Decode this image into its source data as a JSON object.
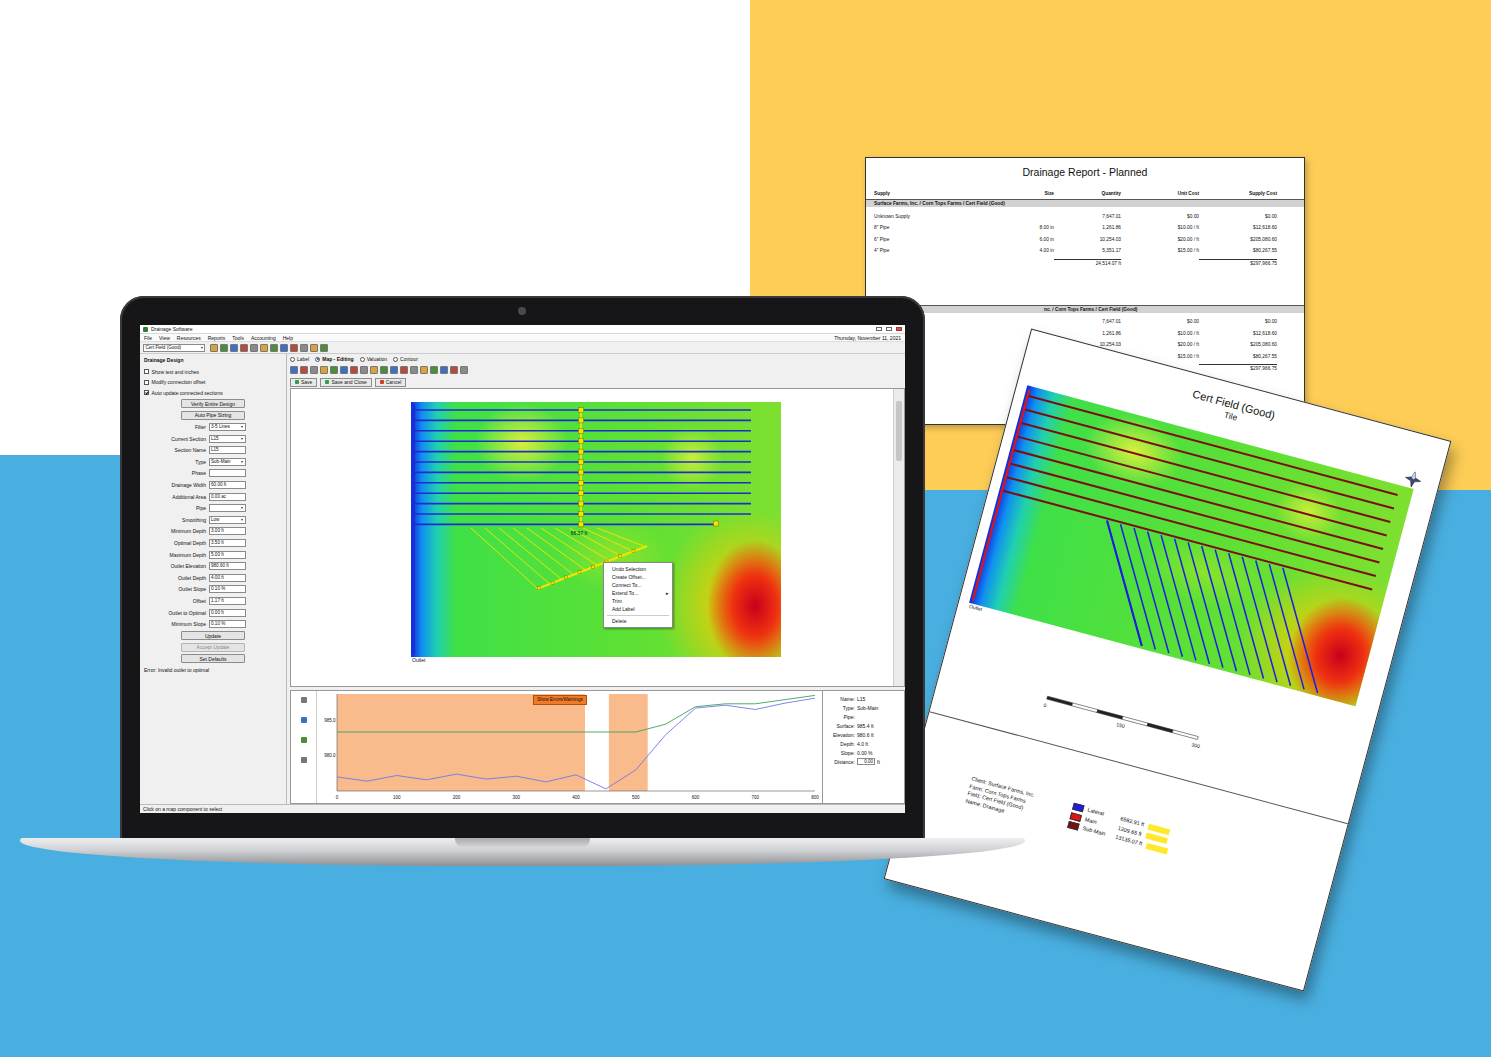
{
  "app": {
    "title": "Drainage Software",
    "menu": [
      "File",
      "View",
      "Resources",
      "Reports",
      "Tools",
      "Accounting",
      "Help"
    ],
    "date": "Thursday, November 11, 2021",
    "field_select": "Cert Field (Good)",
    "panel": {
      "heading": "Drainage Design",
      "items": [
        {
          "kind": "checkbox",
          "label": "Show text and inches",
          "checked": false
        },
        {
          "kind": "checkbox",
          "label": "Modify connection offset",
          "checked": false
        },
        {
          "kind": "checkbox",
          "label": "Auto update connected sections",
          "checked": true
        },
        {
          "kind": "button",
          "label": "Verify Entire Design",
          "disabled": false
        },
        {
          "kind": "button",
          "label": "Auto Pipe Sizing",
          "disabled": false
        },
        {
          "kind": "select",
          "label": "Filter",
          "value": "3-5 Lines"
        },
        {
          "kind": "select",
          "label": "Current Section",
          "value": "L15"
        },
        {
          "kind": "input",
          "label": "Section Name",
          "value": "L15"
        },
        {
          "kind": "select",
          "label": "Type",
          "value": "Sub-Main"
        },
        {
          "kind": "input",
          "label": "Phase"
        },
        {
          "kind": "input",
          "label": "Drainage Width",
          "value": "60.00 ft"
        },
        {
          "kind": "input",
          "label": "Additional Area",
          "value": "0.00 ac"
        },
        {
          "kind": "select",
          "label": "Pipe"
        },
        {
          "kind": "select",
          "label": "Smoothing",
          "value": "Low"
        },
        {
          "kind": "input",
          "label": "Minimum Depth",
          "value": "3.00 ft"
        },
        {
          "kind": "input",
          "label": "Optimal Depth",
          "value": "3.50 ft"
        },
        {
          "kind": "input",
          "label": "Maximum Depth",
          "value": "5.00 ft"
        },
        {
          "kind": "input",
          "label": "Outlet Elevation",
          "value": "980.60 ft"
        },
        {
          "kind": "input",
          "label": "Outlet Depth",
          "value": "4.00 ft"
        },
        {
          "kind": "input",
          "label": "Outlet Slope",
          "value": "0.10 %"
        },
        {
          "kind": "input",
          "label": "Offset",
          "value": "1.17 ft"
        },
        {
          "kind": "input",
          "label": "Outlet to Optimal",
          "value": "0.00 ft"
        },
        {
          "kind": "input",
          "label": "Minimum Slope",
          "value": "0.10 %"
        },
        {
          "kind": "button",
          "label": "Update",
          "disabled": false
        },
        {
          "kind": "button",
          "label": "Accept Update",
          "disabled": true
        },
        {
          "kind": "button",
          "label": "Set Defaults",
          "disabled": false
        },
        {
          "kind": "note",
          "label": "Error: Invalid outlet to optimal"
        }
      ]
    },
    "tabs": [
      {
        "label": "Label",
        "selected": false
      },
      {
        "label": "Map - Editing",
        "selected": true
      },
      {
        "label": "Valuation",
        "selected": false
      },
      {
        "label": "Contour",
        "selected": false
      }
    ],
    "actions": [
      "Save",
      "Save and Close",
      "Cancel"
    ],
    "map": {
      "outlet": "Outlet",
      "section_length": "66.37 ft",
      "groups": [
        {
          "kind": "main",
          "selected": false
        },
        {
          "kind": "laterals",
          "selected": false
        },
        {
          "kind": "sub-main",
          "selected": true
        },
        {
          "kind": "branch",
          "selected": true
        }
      ]
    },
    "context_menu": [
      {
        "kind": "item",
        "label": "Undo Selection"
      },
      {
        "kind": "item",
        "label": "Create Offset..."
      },
      {
        "kind": "item",
        "label": "Connect To..."
      },
      {
        "kind": "submenu",
        "label": "Extend To...",
        "arrow": "▸"
      },
      {
        "kind": "item",
        "label": "Trim"
      },
      {
        "kind": "item",
        "label": "Add Label"
      },
      {
        "kind": "separator"
      },
      {
        "kind": "item",
        "label": "Delete"
      }
    ],
    "profile": {
      "button": "Show Errors/Warnings",
      "y_ticks": [
        "985.0",
        "980.0"
      ],
      "x_ticks": [
        "0",
        "100",
        "200",
        "300",
        "400",
        "500",
        "600",
        "700",
        "800"
      ],
      "distance": [
        0,
        50,
        100,
        150,
        200,
        250,
        300,
        350,
        400,
        450,
        500,
        550,
        600,
        650,
        700,
        750,
        800
      ],
      "series": [
        {
          "name": "Surface",
          "color": "#6f78ec",
          "values": [
            977.0,
            976.4,
            977.2,
            976.6,
            977.4,
            976.7,
            977.1,
            976.3,
            977.3,
            975.3,
            978.0,
            983.0,
            986.8,
            987.2,
            986.6,
            987.5,
            988.2
          ]
        },
        {
          "name": "Pipe",
          "color": "#3aa35a",
          "values": [
            983.4,
            983.4,
            983.4,
            983.4,
            983.4,
            983.4,
            983.4,
            983.4,
            983.4,
            983.4,
            983.4,
            984.5,
            987.0,
            987.4,
            987.4,
            988.0,
            988.6
          ]
        }
      ],
      "warnings": [
        {
          "start": 0,
          "end": 415
        },
        {
          "start": 455,
          "end": 520
        }
      ],
      "info": [
        {
          "kind": "text",
          "label": "Name:",
          "value": "L15"
        },
        {
          "kind": "text",
          "label": "Type:",
          "value": "Sub-Main"
        },
        {
          "kind": "text",
          "label": "Pipe:"
        },
        {
          "kind": "text",
          "label": "Surface:",
          "value": "985.4 ft"
        },
        {
          "kind": "text",
          "label": "Elevation:",
          "value": "980.6 ft"
        },
        {
          "kind": "text",
          "label": "Depth:",
          "value": "4.0 ft"
        },
        {
          "kind": "text",
          "label": "Slope:",
          "value": "0.00 %"
        },
        {
          "kind": "input",
          "label": "Distance:",
          "value": "0.00",
          "unit": "ft"
        }
      ]
    },
    "status": "Click on a map component to select"
  },
  "report": {
    "title": "Drainage Report - Planned",
    "columns": [
      "Supply",
      "Size",
      "Quantity",
      "Unit Cost",
      "Supply Cost"
    ],
    "groups": [
      {
        "label": "Surface Farms, Inc. / Corn Tops Farms / Cert Field (Good)",
        "rows": [
          {
            "supply": "Unknown Supply",
            "quantity": "7,647.01",
            "unit_cost": "$0.00",
            "cost": "$0.00"
          },
          {
            "supply": "8\" Pipe",
            "size": "8.00 in",
            "quantity": "1,261.86",
            "unit_cost": "$10.00 / ft",
            "cost": "$12,618.60"
          },
          {
            "supply": "6\" Pipe",
            "size": "6.00 in",
            "quantity": "10,254.03",
            "unit_cost": "$20.00 / ft",
            "cost": "$205,080.60"
          },
          {
            "supply": "4\" Pipe",
            "size": "4.00 in",
            "quantity": "5,351.17",
            "unit_cost": "$15.00 / ft",
            "cost": "$80,267.55"
          }
        ],
        "total": {
          "quantity": "24,514.07 ft",
          "cost": "$297,966.75"
        }
      },
      {
        "label": "nc. / Corn Tops Farms / Cert Field (Good)",
        "rows": [
          {
            "quantity": "7,647.01",
            "unit_cost": "$0.00",
            "cost": "$0.00"
          },
          {
            "quantity": "1,261.86",
            "unit_cost": "$10.00 / ft",
            "cost": "$12,618.60"
          },
          {
            "quantity": "10,254.03",
            "unit_cost": "$20.00 / ft",
            "cost": "$205,080.60"
          },
          {
            "unit_cost": "$15.00 / ft",
            "cost": "$80,267.55"
          }
        ],
        "total": {
          "cost": "$297,966.75"
        }
      }
    ]
  },
  "map_doc": {
    "title": "Cert Field (Good)",
    "subtitle": "Tile",
    "outlet": "Outlet",
    "scale_ticks": [
      "0",
      "150",
      "300"
    ],
    "client_info": [
      "Client: Surface Farms, Inc.",
      "Farm: Corn Tops Farms",
      "Field: Cert Field (Good)",
      "Name: Drainage"
    ],
    "legend": [
      {
        "label": "Lateral",
        "value": "6582.91 ft",
        "color": "#1d1de0"
      },
      {
        "label": "Main",
        "value": "1209.65 ft",
        "color": "#e01414"
      },
      {
        "label": "Sub-Main",
        "value": "13135.07 ft",
        "color": "#7a0f0f"
      }
    ]
  }
}
